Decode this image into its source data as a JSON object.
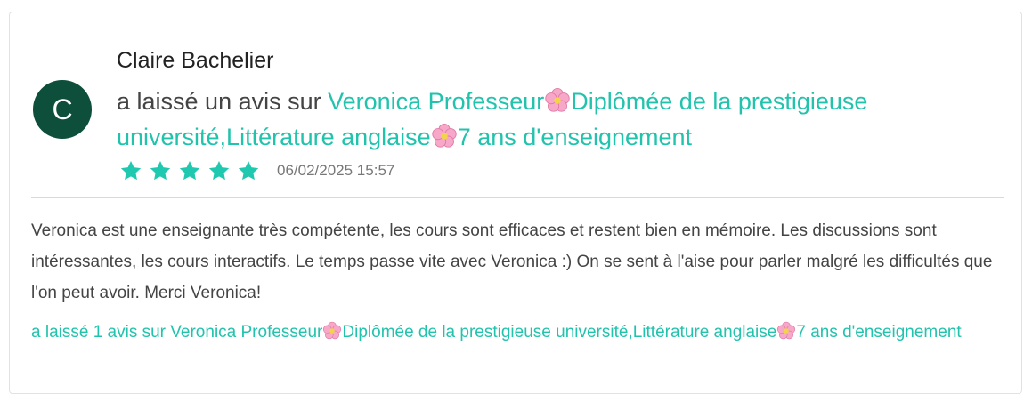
{
  "review": {
    "author_initial": "C",
    "author_name": "Claire Bachelier",
    "action_text": " a laissé un avis sur ",
    "tutor_part1": "Veronica Professeur",
    "tutor_part2": "Diplômée de la prestigieuse université,Littérature anglaise",
    "tutor_part3": "7 ans d'enseignement",
    "flower_icon": "cherry-blossom-icon",
    "rating": 5,
    "rating_max": 5,
    "date": "06/02/2025 15:57",
    "body": "Veronica est une enseignante très compétente, les cours sont efficaces et restent bien en mémoire. Les discussions sont intéressantes, les cours interactifs. Le temps passe vite avec Veronica :) On se sent à l'aise pour parler malgré les difficultés que l'on peut avoir. Merci Veronica!",
    "footer_prefix": "a laissé 1 avis sur Veronica Professeur",
    "footer_part2": "Diplômée de la prestigieuse université,Littérature anglaise",
    "footer_part3": "7 ans d'enseignement"
  },
  "colors": {
    "accent": "#22c3ad",
    "avatar_bg": "#0e4f3c",
    "star": "#1ec9b0"
  }
}
